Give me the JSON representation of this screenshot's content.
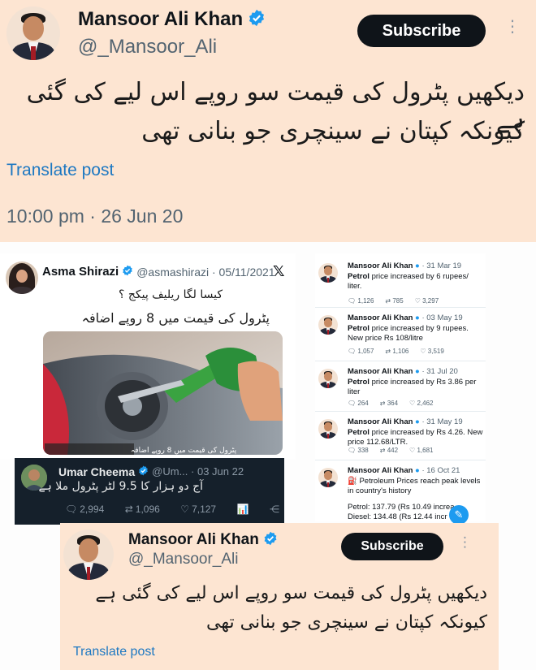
{
  "top_tweet": {
    "name": "Mansoor Ali Khan",
    "handle": "@_Mansoor_Ali",
    "subscribe": "Subscribe",
    "urdu_line1": "دیکھیں پٹرول کی قیمت سو روپے اس لیے کی گئی ہے",
    "urdu_line2": "کیونکہ کپتان نے سینچری جو بنانی تھی",
    "translate": "Translate post",
    "timestamp": "10:00 pm · 26 Jun 20"
  },
  "asma_tweet": {
    "name": "Asma Shirazi",
    "handle": "@asmashirazi · 05/11/2021",
    "urdu_line1": "کیسا لگا ریلیف پیکج ؟",
    "urdu_line2": "پٹرول کی قیمت میں 8 روپے اضافہ",
    "image_caption": "پٹرول کی قیمت میں 8 روپے اضافہ"
  },
  "umar_tweet": {
    "name": "Umar Cheema",
    "handle": "@Um... · 03 Jun 22",
    "urdu": "آج دو ہزار کا 9.5 لٹر پٹرول ملا ہے",
    "replies": "2,994",
    "retweets": "1,096",
    "likes": "7,127"
  },
  "mini_tweets": [
    {
      "name": "Mansoor Ali Khan",
      "date": "· 31 Mar 19",
      "bold": "Petrol",
      "text": " price increased by 6 rupees/ liter.",
      "replies": "1,126",
      "retweets": "785",
      "likes": "3,297"
    },
    {
      "name": "Mansoor Ali Khan",
      "date": "· 03 May 19",
      "bold": "Petrol",
      "text": " price increased by 9 rupees. New price Rs 108/litre",
      "replies": "1,057",
      "retweets": "1,106",
      "likes": "3,519"
    },
    {
      "name": "Mansoor Ali Khan",
      "date": "· 31 Jul 20",
      "bold": "Petrol",
      "text": " price increased by Rs 3.86 per liter",
      "replies": "264",
      "retweets": "364",
      "likes": "2,462"
    },
    {
      "name": "Mansoor Ali Khan",
      "date": "· 31 May 19",
      "bold": "Petrol",
      "text": " price increased by Rs 4.26. New price 112.68/LTR.",
      "replies": "338",
      "retweets": "442",
      "likes": "1,681"
    },
    {
      "name": "Mansoor Ali Khan",
      "date": "· 16 Oct 21",
      "bold": "",
      "text": "⛽ Petroleum Prices reach peak levels in country's history"
    }
  ],
  "fuel_lines": {
    "petrol": "Petrol: 137.79 (Rs 10.49 increa",
    "diesel": "Diesel: 134.48 (Rs 12.44 incr"
  },
  "bottom_tweet": {
    "name": "Mansoor Ali Khan",
    "handle": "@_Mansoor_Ali",
    "subscribe": "Subscribe",
    "urdu_line1": "دیکھیں پٹرول کی قیمت سو روپے اس لیے کی گئی ہے",
    "urdu_line2": "کیونکہ کپتان نے سینچری جو بنانی تھی",
    "translate": "Translate post"
  },
  "colors": {
    "card_bg": "#fde5d2",
    "verified": "#1d9bf0",
    "link": "#1d78c2"
  }
}
